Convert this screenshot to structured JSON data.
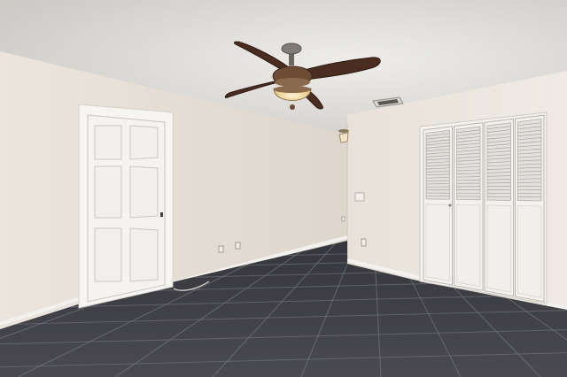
{
  "scene": {
    "kind": "empty-bedroom-photo",
    "objects": [
      "textured-ceiling",
      "ceiling-fan",
      "air-vent",
      "wall-light",
      "six-panel-door",
      "bifold-louvered-closet",
      "light-switch",
      "outlets",
      "tile-floor"
    ]
  },
  "colors": {
    "ceiling": "#e9e7e3",
    "left_wall": "#e6e0d8",
    "right_wall": "#ece7e0",
    "back_wall": "#e4ded6",
    "floor": "#3f4046",
    "grout": "#777880",
    "door": "#f4f3f1",
    "trim": "#f7f6f4",
    "fan_blade": "#4a2c20",
    "fan_metal": "#6b6761",
    "glass": "#f6e5b8"
  },
  "closet": {
    "panel_count": 4
  },
  "door": {
    "panel_count": 6
  },
  "fan": {
    "blade_count": 4
  }
}
